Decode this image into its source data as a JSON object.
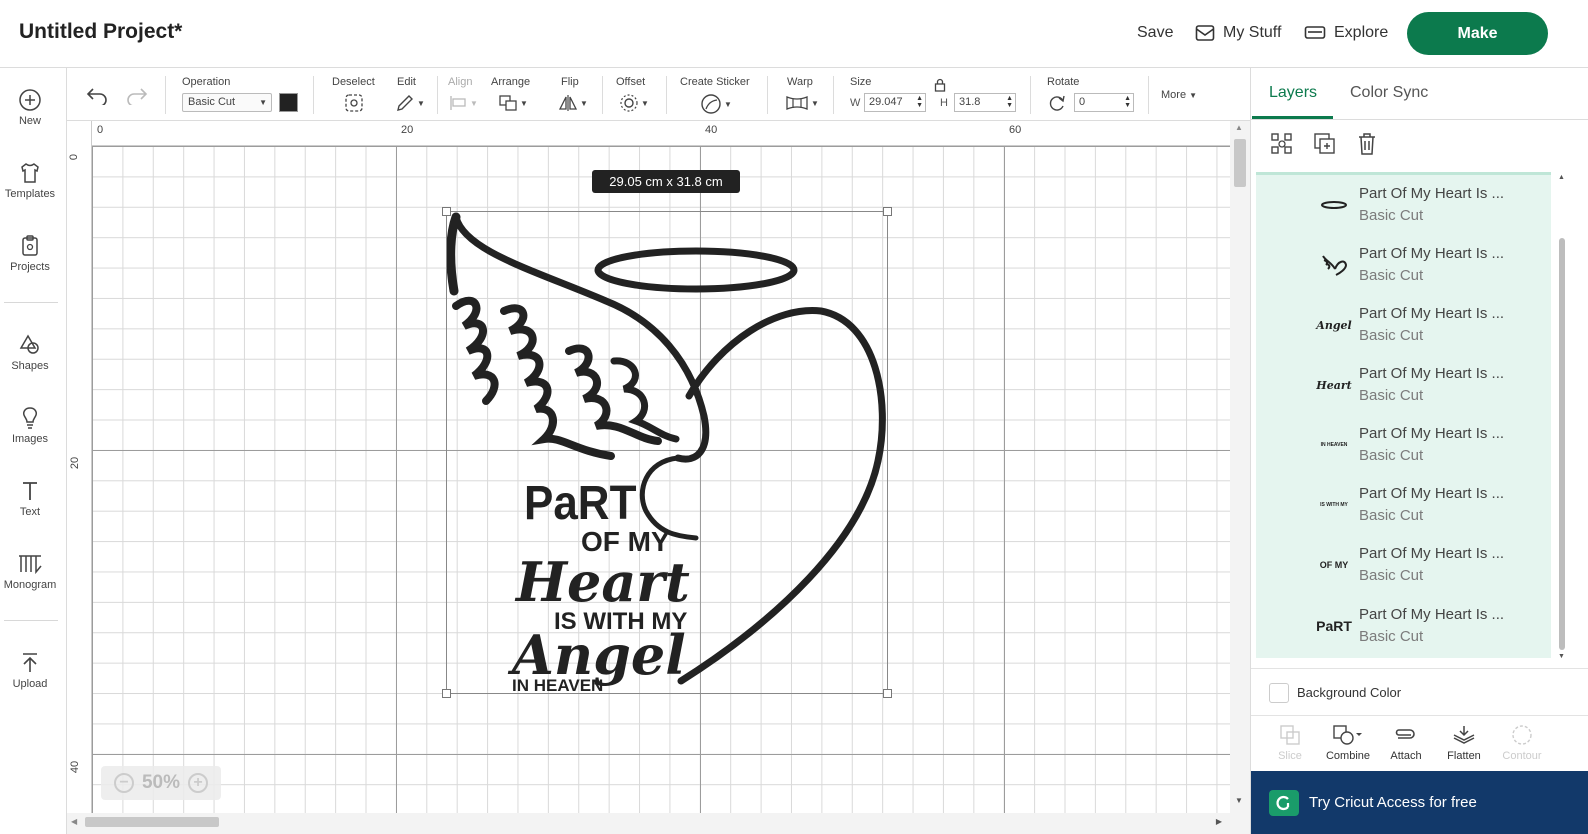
{
  "header": {
    "title": "Untitled Project*",
    "save_label": "Save",
    "mystuff_label": "My Stuff",
    "explore_label": "Explore",
    "make_label": "Make"
  },
  "sidebar": {
    "items": [
      {
        "label": "New",
        "icon": "plus-circle-icon"
      },
      {
        "label": "Templates",
        "icon": "shirt-icon"
      },
      {
        "label": "Projects",
        "icon": "clipboard-icon"
      },
      {
        "label": "Shapes",
        "icon": "shapes-icon"
      },
      {
        "label": "Images",
        "icon": "lightbulb-icon"
      },
      {
        "label": "Text",
        "icon": "text-t-icon"
      },
      {
        "label": "Monogram",
        "icon": "monogram-icon"
      },
      {
        "label": "Upload",
        "icon": "upload-arrow-icon"
      }
    ]
  },
  "toolbar": {
    "operation_label": "Operation",
    "operation_value": "Basic Cut",
    "operation_color": "#222222",
    "deselect_label": "Deselect",
    "edit_label": "Edit",
    "align_label": "Align",
    "arrange_label": "Arrange",
    "flip_label": "Flip",
    "offset_label": "Offset",
    "create_sticker_label": "Create Sticker",
    "warp_label": "Warp",
    "size_label": "Size",
    "width_prefix": "W",
    "width_value": "29.047",
    "height_prefix": "H",
    "height_value": "31.8",
    "rotate_label": "Rotate",
    "rotate_value": "0",
    "more_label": "More"
  },
  "canvas": {
    "ruler_top": [
      "0",
      "20",
      "40",
      "60"
    ],
    "ruler_left": [
      "0",
      "20",
      "40"
    ],
    "dimension_badge": "29.05  cm x 31.8  cm",
    "zoom_level": "50%",
    "design_text": {
      "line1": "PaRT",
      "line2": "OF MY",
      "line3": "Heart",
      "line4": "IS WITH MY",
      "line5": "Angel",
      "line6": "IN HEAVEN"
    }
  },
  "right_panel": {
    "tabs": [
      "Layers",
      "Color Sync"
    ],
    "layers": [
      {
        "name": "Part Of My Heart Is ...",
        "operation": "Basic Cut",
        "thumb": "halo-thumb-icon"
      },
      {
        "name": "Part Of My Heart Is ...",
        "operation": "Basic Cut",
        "thumb": "wing-heart-thumb-icon",
        "thumb_text": ""
      },
      {
        "name": "Part Of My Heart Is ...",
        "operation": "Basic Cut",
        "thumb": "angel-text-thumb-icon",
        "thumb_text": "Angel"
      },
      {
        "name": "Part Of My Heart Is ...",
        "operation": "Basic Cut",
        "thumb": "heart-text-thumb-icon",
        "thumb_text": "Heart"
      },
      {
        "name": "Part Of My Heart Is ...",
        "operation": "Basic Cut",
        "thumb": "in-heaven-thumb-icon",
        "thumb_text": "IN HEAVEN"
      },
      {
        "name": "Part Of My Heart Is ...",
        "operation": "Basic Cut",
        "thumb": "is-with-my-thumb-icon",
        "thumb_text": "IS WITH MY"
      },
      {
        "name": "Part Of My Heart Is ...",
        "operation": "Basic Cut",
        "thumb": "of-my-thumb-icon",
        "thumb_text": "OF MY"
      },
      {
        "name": "Part Of My Heart Is ...",
        "operation": "Basic Cut",
        "thumb": "part-thumb-icon",
        "thumb_text": "PaRT"
      }
    ],
    "background_color_label": "Background Color",
    "bottom_tools": [
      {
        "label": "Slice",
        "enabled": false
      },
      {
        "label": "Combine",
        "enabled": true
      },
      {
        "label": "Attach",
        "enabled": true
      },
      {
        "label": "Flatten",
        "enabled": true
      },
      {
        "label": "Contour",
        "enabled": false
      }
    ],
    "access_banner": "Try Cricut Access for free"
  },
  "colors": {
    "brand_green": "#0c7a4d",
    "layer_bg": "#e5f5ef",
    "banner_navy": "#12396a"
  }
}
